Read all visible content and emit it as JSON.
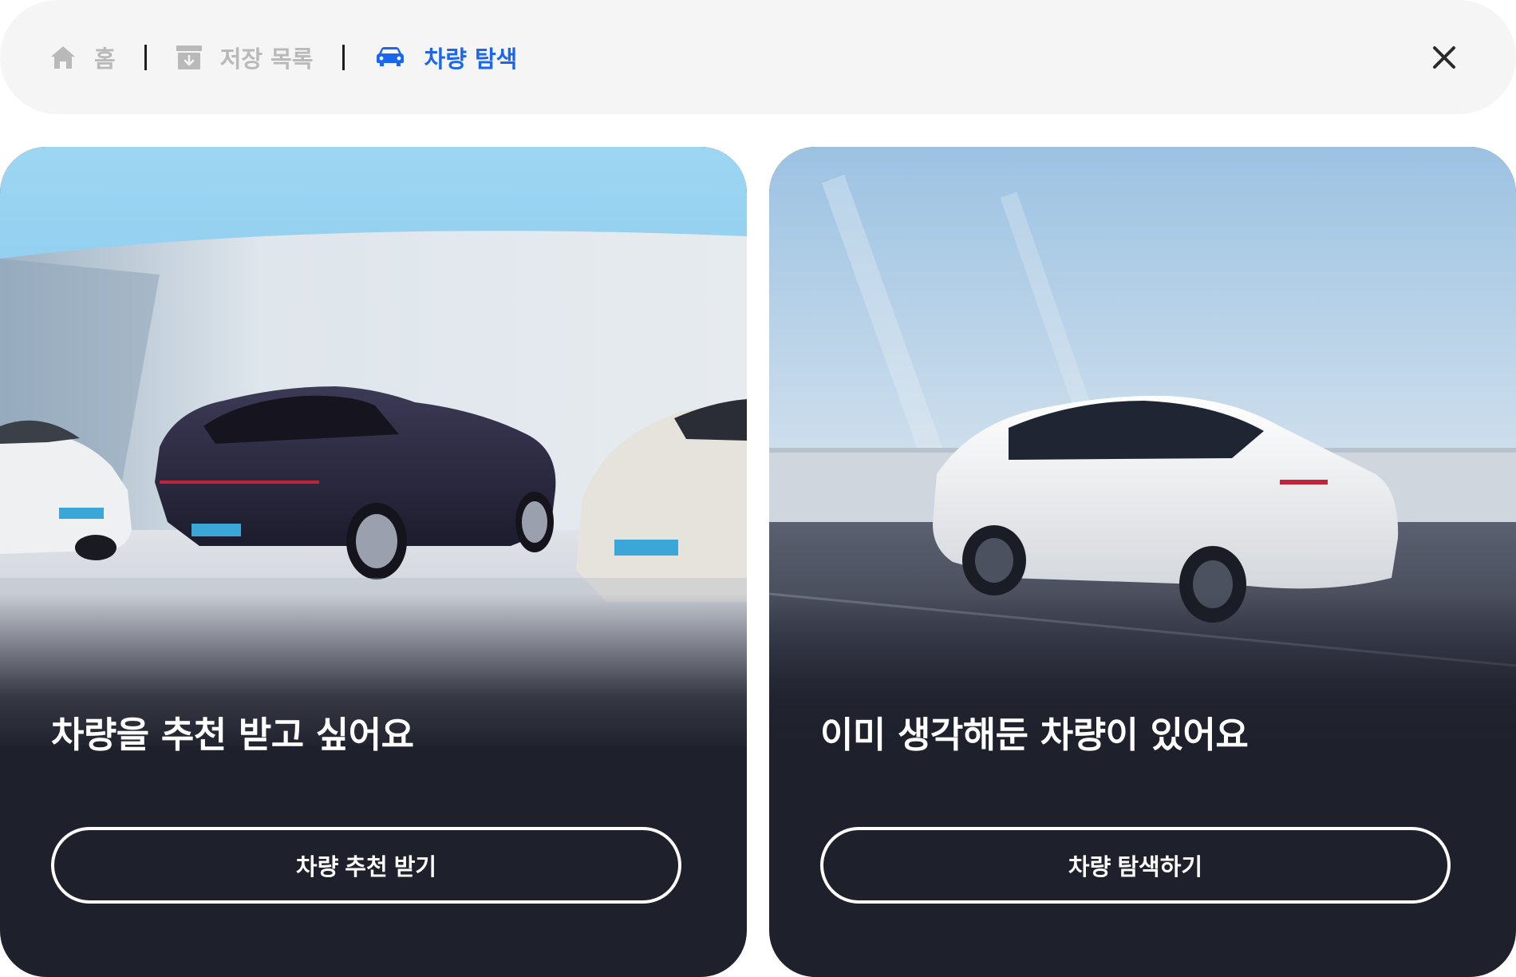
{
  "nav": {
    "items": [
      {
        "label": "홈",
        "icon": "home-icon",
        "state": "inactive"
      },
      {
        "label": "저장 목록",
        "icon": "archive-download-icon",
        "state": "inactive"
      },
      {
        "label": "차량 탐색",
        "icon": "car-icon",
        "state": "active"
      }
    ],
    "close_icon": "close-icon"
  },
  "colors": {
    "active": "#1a66f0",
    "inactive": "#b9b9b9",
    "nav_background": "#f5f5f5",
    "card_background": "#1e202c"
  },
  "cards": [
    {
      "title": "차량을 추천 받고 싶어요",
      "button_label": "차량 추천 받기",
      "image": "three-sedans-photo"
    },
    {
      "title": "이미 생각해둔 차량이 있어요",
      "button_label": "차량 탐색하기",
      "image": "white-suv-on-highway-photo"
    }
  ]
}
